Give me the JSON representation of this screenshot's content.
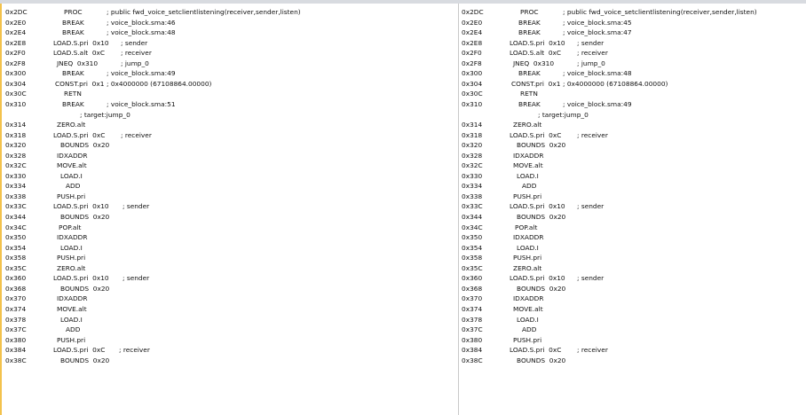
{
  "left_pane": {
    "rows": [
      {
        "addr": "0x2DC",
        "ins": "PROC",
        "indent": 70,
        "comment": "; public fwd_voice_setclientlistening(receiver,sender,listen)",
        "ccol": 118
      },
      {
        "addr": "0x2E0",
        "ins": "BREAK",
        "indent": 68,
        "comment": "; voice_block.sma:46",
        "ccol": 118
      },
      {
        "addr": "0x2E4",
        "ins": "BREAK",
        "indent": 68,
        "comment": "; voice_block.sma:48",
        "ccol": 118
      },
      {
        "addr": "0x2E8",
        "ins": "LOAD.S.pri  0x10",
        "indent": 58,
        "comment": "; sender",
        "ccol": 134
      },
      {
        "addr": "0x2F0",
        "ins": "LOAD.S.alt  0xC",
        "indent": 58,
        "comment": "; receiver",
        "ccol": 134
      },
      {
        "addr": "0x2F8",
        "ins": "JNEQ  0x310",
        "indent": 62,
        "comment": "; jump_0",
        "ccol": 134
      },
      {
        "addr": "0x300",
        "ins": "BREAK",
        "indent": 68,
        "comment": "; voice_block.sma:49",
        "ccol": 118
      },
      {
        "addr": "0x304",
        "ins": "CONST.pri  0x1",
        "indent": 60,
        "comment": "; 0x4000000 (67108864.00000)",
        "ccol": 118
      },
      {
        "addr": "0x30C",
        "ins": "RETN",
        "indent": 70,
        "comment": "",
        "ccol": 118
      },
      {
        "addr": "0x310",
        "ins": "BREAK",
        "indent": 68,
        "comment": "; voice_block.sma:51",
        "ccol": 118
      },
      {
        "addr": "",
        "ins": "",
        "indent": 0,
        "comment": "",
        "ccol": 0,
        "label": "; target:jump_0",
        "lcol": 88
      },
      {
        "addr": "0x314",
        "ins": "ZERO.alt",
        "indent": 62,
        "comment": "",
        "ccol": 0
      },
      {
        "addr": "0x318",
        "ins": "LOAD.S.pri  0xC",
        "indent": 58,
        "comment": "; receiver",
        "ccol": 134
      },
      {
        "addr": "0x320",
        "ins": "BOUNDS  0x20",
        "indent": 66,
        "comment": "",
        "ccol": 0
      },
      {
        "addr": "0x328",
        "ins": "IDXADDR",
        "indent": 62,
        "comment": "",
        "ccol": 0
      },
      {
        "addr": "0x32C",
        "ins": "MOVE.alt",
        "indent": 62,
        "comment": "",
        "ccol": 0
      },
      {
        "addr": "0x330",
        "ins": "LOAD.I",
        "indent": 66,
        "comment": "",
        "ccol": 0
      },
      {
        "addr": "0x334",
        "ins": "ADD",
        "indent": 72,
        "comment": "",
        "ccol": 0
      },
      {
        "addr": "0x338",
        "ins": "PUSH.pri",
        "indent": 62,
        "comment": "",
        "ccol": 0
      },
      {
        "addr": "0x33C",
        "ins": "LOAD.S.pri  0x10",
        "indent": 58,
        "comment": "; sender",
        "ccol": 136
      },
      {
        "addr": "0x344",
        "ins": "BOUNDS  0x20",
        "indent": 66,
        "comment": "",
        "ccol": 0
      },
      {
        "addr": "0x34C",
        "ins": "POP.alt",
        "indent": 64,
        "comment": "",
        "ccol": 0
      },
      {
        "addr": "0x350",
        "ins": "IDXADDR",
        "indent": 62,
        "comment": "",
        "ccol": 0
      },
      {
        "addr": "0x354",
        "ins": "LOAD.I",
        "indent": 66,
        "comment": "",
        "ccol": 0
      },
      {
        "addr": "0x358",
        "ins": "PUSH.pri",
        "indent": 62,
        "comment": "",
        "ccol": 0
      },
      {
        "addr": "0x35C",
        "ins": "ZERO.alt",
        "indent": 62,
        "comment": "",
        "ccol": 0
      },
      {
        "addr": "0x360",
        "ins": "LOAD.S.pri  0x10",
        "indent": 58,
        "comment": "; sender",
        "ccol": 136
      },
      {
        "addr": "0x368",
        "ins": "BOUNDS  0x20",
        "indent": 66,
        "comment": "",
        "ccol": 0
      },
      {
        "addr": "0x370",
        "ins": "IDXADDR",
        "indent": 62,
        "comment": "",
        "ccol": 0
      },
      {
        "addr": "0x374",
        "ins": "MOVE.alt",
        "indent": 62,
        "comment": "",
        "ccol": 0
      },
      {
        "addr": "0x378",
        "ins": "LOAD.I",
        "indent": 66,
        "comment": "",
        "ccol": 0
      },
      {
        "addr": "0x37C",
        "ins": "ADD",
        "indent": 72,
        "comment": "",
        "ccol": 0
      },
      {
        "addr": "0x380",
        "ins": "PUSH.pri",
        "indent": 62,
        "comment": "",
        "ccol": 0
      },
      {
        "addr": "0x384",
        "ins": "LOAD.S.pri  0xC",
        "indent": 58,
        "comment": "; receiver",
        "ccol": 132
      },
      {
        "addr": "0x38C",
        "ins": "BOUNDS  0x20",
        "indent": 66,
        "comment": "",
        "ccol": 0
      }
    ]
  },
  "right_pane": {
    "rows": [
      {
        "addr": "0x2DC",
        "ins": "PROC",
        "indent": 70,
        "comment": "; public fwd_voice_setclientlistening(receiver,sender,listen)",
        "ccol": 118
      },
      {
        "addr": "0x2E0",
        "ins": "BREAK",
        "indent": 68,
        "comment": "; voice_block.sma:45",
        "ccol": 118
      },
      {
        "addr": "0x2E4",
        "ins": "BREAK",
        "indent": 68,
        "comment": "; voice_block.sma:47",
        "ccol": 118
      },
      {
        "addr": "0x2E8",
        "ins": "LOAD.S.pri  0x10",
        "indent": 58,
        "comment": "; sender",
        "ccol": 134
      },
      {
        "addr": "0x2F0",
        "ins": "LOAD.S.alt  0xC",
        "indent": 58,
        "comment": "; receiver",
        "ccol": 134
      },
      {
        "addr": "0x2F8",
        "ins": "JNEQ  0x310",
        "indent": 62,
        "comment": "; jump_0",
        "ccol": 134
      },
      {
        "addr": "0x300",
        "ins": "BREAK",
        "indent": 68,
        "comment": "; voice_block.sma:48",
        "ccol": 118
      },
      {
        "addr": "0x304",
        "ins": "CONST.pri  0x1",
        "indent": 60,
        "comment": "; 0x4000000 (67108864.00000)",
        "ccol": 118
      },
      {
        "addr": "0x30C",
        "ins": "RETN",
        "indent": 70,
        "comment": "",
        "ccol": 118
      },
      {
        "addr": "0x310",
        "ins": "BREAK",
        "indent": 68,
        "comment": "; voice_block.sma:49",
        "ccol": 118
      },
      {
        "addr": "",
        "ins": "",
        "indent": 0,
        "comment": "",
        "ccol": 0,
        "label": "; target:jump_0",
        "lcol": 90
      },
      {
        "addr": "0x314",
        "ins": "ZERO.alt",
        "indent": 62,
        "comment": "",
        "ccol": 0
      },
      {
        "addr": "0x318",
        "ins": "LOAD.S.pri  0xC",
        "indent": 58,
        "comment": "; receiver",
        "ccol": 134
      },
      {
        "addr": "0x320",
        "ins": "BOUNDS  0x20",
        "indent": 66,
        "comment": "",
        "ccol": 0
      },
      {
        "addr": "0x328",
        "ins": "IDXADDR",
        "indent": 62,
        "comment": "",
        "ccol": 0
      },
      {
        "addr": "0x32C",
        "ins": "MOVE.alt",
        "indent": 62,
        "comment": "",
        "ccol": 0
      },
      {
        "addr": "0x330",
        "ins": "LOAD.I",
        "indent": 66,
        "comment": "",
        "ccol": 0
      },
      {
        "addr": "0x334",
        "ins": "ADD",
        "indent": 72,
        "comment": "",
        "ccol": 0
      },
      {
        "addr": "0x338",
        "ins": "PUSH.pri",
        "indent": 62,
        "comment": "",
        "ccol": 0
      },
      {
        "addr": "0x33C",
        "ins": "LOAD.S.pri  0x10",
        "indent": 58,
        "comment": "; sender",
        "ccol": 134
      },
      {
        "addr": "0x344",
        "ins": "BOUNDS  0x20",
        "indent": 66,
        "comment": "",
        "ccol": 0
      },
      {
        "addr": "0x34C",
        "ins": "POP.alt",
        "indent": 64,
        "comment": "",
        "ccol": 0
      },
      {
        "addr": "0x350",
        "ins": "IDXADDR",
        "indent": 62,
        "comment": "",
        "ccol": 0
      },
      {
        "addr": "0x354",
        "ins": "LOAD.I",
        "indent": 66,
        "comment": "",
        "ccol": 0
      },
      {
        "addr": "0x358",
        "ins": "PUSH.pri",
        "indent": 62,
        "comment": "",
        "ccol": 0
      },
      {
        "addr": "0x35C",
        "ins": "ZERO.alt",
        "indent": 62,
        "comment": "",
        "ccol": 0
      },
      {
        "addr": "0x360",
        "ins": "LOAD.S.pri  0x10",
        "indent": 58,
        "comment": "; sender",
        "ccol": 134
      },
      {
        "addr": "0x368",
        "ins": "BOUNDS  0x20",
        "indent": 66,
        "comment": "",
        "ccol": 0
      },
      {
        "addr": "0x370",
        "ins": "IDXADDR",
        "indent": 62,
        "comment": "",
        "ccol": 0
      },
      {
        "addr": "0x374",
        "ins": "MOVE.alt",
        "indent": 62,
        "comment": "",
        "ccol": 0
      },
      {
        "addr": "0x378",
        "ins": "LOAD.I",
        "indent": 66,
        "comment": "",
        "ccol": 0
      },
      {
        "addr": "0x37C",
        "ins": "ADD",
        "indent": 72,
        "comment": "",
        "ccol": 0
      },
      {
        "addr": "0x380",
        "ins": "PUSH.pri",
        "indent": 62,
        "comment": "",
        "ccol": 0
      },
      {
        "addr": "0x384",
        "ins": "LOAD.S.pri  0xC",
        "indent": 58,
        "comment": "; receiver",
        "ccol": 134
      },
      {
        "addr": "0x38C",
        "ins": "BOUNDS  0x20",
        "indent": 66,
        "comment": "",
        "ccol": 0
      }
    ]
  }
}
